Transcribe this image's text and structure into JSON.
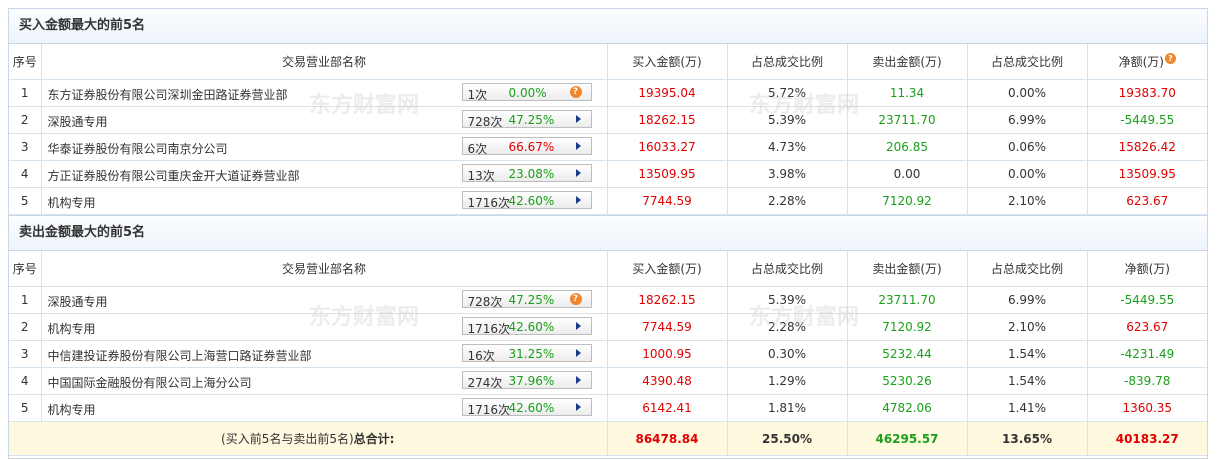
{
  "buy_section": {
    "title": "买入金额最大的前5名",
    "headers": [
      "序号",
      "交易营业部名称",
      "买入金额(万)",
      "占总成交比例",
      "卖出金额(万)",
      "占总成交比例",
      "净额(万)"
    ],
    "rows": [
      {
        "idx": "1",
        "name": "东方证券股份有限公司深圳金田路证券营业部",
        "count": "1次",
        "pct": "0.00%",
        "buy": "19395.04",
        "buy_ratio": "5.72%",
        "sell": "11.34",
        "sell_ratio": "0.00%",
        "net": "19383.70",
        "net_sign": "pos",
        "icon": "question"
      },
      {
        "idx": "2",
        "name": "深股通专用",
        "count": "728次",
        "pct": "47.25%",
        "buy": "18262.15",
        "buy_ratio": "5.39%",
        "sell": "23711.70",
        "sell_ratio": "6.99%",
        "net": "-5449.55",
        "net_sign": "neg",
        "icon": "arrow"
      },
      {
        "idx": "3",
        "name": "华泰证券股份有限公司南京分公司",
        "count": "6次",
        "pct": "66.67%",
        "buy": "16033.27",
        "buy_ratio": "4.73%",
        "sell": "206.85",
        "sell_ratio": "0.06%",
        "net": "15826.42",
        "net_sign": "pos",
        "icon": "arrow",
        "pct_red": true
      },
      {
        "idx": "4",
        "name": "方正证券股份有限公司重庆金开大道证券营业部",
        "count": "13次",
        "pct": "23.08%",
        "buy": "13509.95",
        "buy_ratio": "3.98%",
        "sell": "0.00",
        "sell_ratio": "0.00%",
        "net": "13509.95",
        "net_sign": "pos",
        "icon": "arrow",
        "sell_black": true
      },
      {
        "idx": "5",
        "name": "机构专用",
        "count": "1716次",
        "pct": "42.60%",
        "buy": "7744.59",
        "buy_ratio": "2.28%",
        "sell": "7120.92",
        "sell_ratio": "2.10%",
        "net": "623.67",
        "net_sign": "pos",
        "icon": "arrow"
      }
    ]
  },
  "sell_section": {
    "title": "卖出金额最大的前5名",
    "headers": [
      "序号",
      "交易营业部名称",
      "买入金额(万)",
      "占总成交比例",
      "卖出金额(万)",
      "占总成交比例",
      "净额(万)"
    ],
    "rows": [
      {
        "idx": "1",
        "name": "深股通专用",
        "count": "728次",
        "pct": "47.25%",
        "buy": "18262.15",
        "buy_ratio": "5.39%",
        "sell": "23711.70",
        "sell_ratio": "6.99%",
        "net": "-5449.55",
        "net_sign": "neg",
        "icon": "question"
      },
      {
        "idx": "2",
        "name": "机构专用",
        "count": "1716次",
        "pct": "42.60%",
        "buy": "7744.59",
        "buy_ratio": "2.28%",
        "sell": "7120.92",
        "sell_ratio": "2.10%",
        "net": "623.67",
        "net_sign": "pos",
        "icon": "arrow"
      },
      {
        "idx": "3",
        "name": "中信建投证券股份有限公司上海营口路证券营业部",
        "count": "16次",
        "pct": "31.25%",
        "buy": "1000.95",
        "buy_ratio": "0.30%",
        "sell": "5232.44",
        "sell_ratio": "1.54%",
        "net": "-4231.49",
        "net_sign": "neg",
        "icon": "arrow"
      },
      {
        "idx": "4",
        "name": "中国国际金融股份有限公司上海分公司",
        "count": "274次",
        "pct": "37.96%",
        "buy": "4390.48",
        "buy_ratio": "1.29%",
        "sell": "5230.26",
        "sell_ratio": "1.54%",
        "net": "-839.78",
        "net_sign": "neg",
        "icon": "arrow"
      },
      {
        "idx": "5",
        "name": "机构专用",
        "count": "1716次",
        "pct": "42.60%",
        "buy": "6142.41",
        "buy_ratio": "1.81%",
        "sell": "4782.06",
        "sell_ratio": "1.41%",
        "net": "1360.35",
        "net_sign": "pos",
        "icon": "arrow"
      }
    ],
    "total": {
      "label_prefix": "(买入前5名与卖出前5名)",
      "label_bold": "总合计:",
      "buy": "86478.84",
      "buy_ratio": "25.50%",
      "sell": "46295.57",
      "sell_ratio": "13.65%",
      "net": "40183.27"
    }
  },
  "colors": {
    "positive": "#e00000",
    "negative": "#1aa01a",
    "accent": "#f0872a",
    "border": "#c9d8e8",
    "total_bg": "#fff9e0"
  },
  "icons": {
    "question": "question-icon",
    "arrow": "right-arrow-icon"
  }
}
